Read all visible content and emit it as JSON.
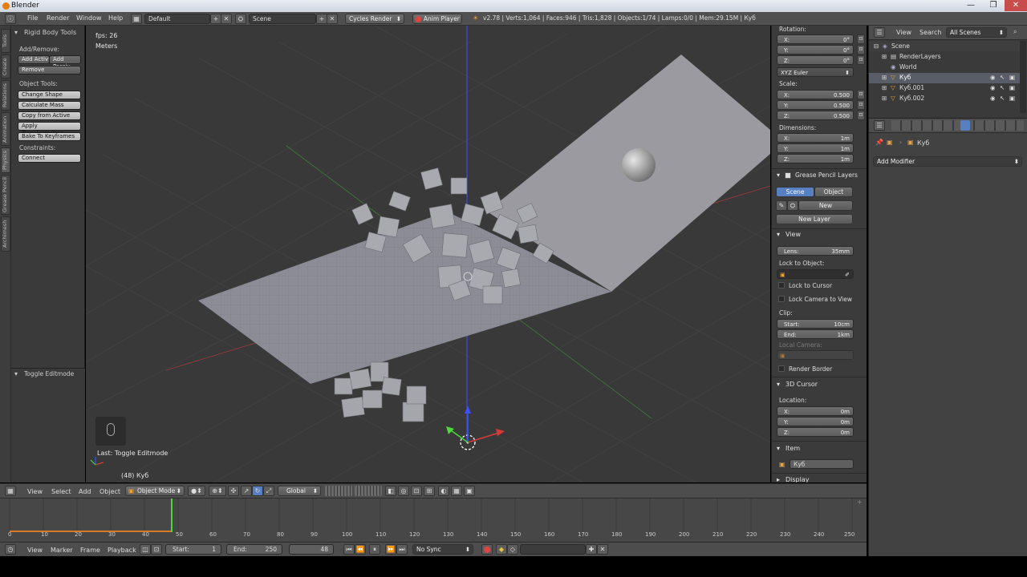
{
  "window": {
    "title": "Blender",
    "controls": [
      "—",
      "❐",
      "✕"
    ]
  },
  "menubar": {
    "menus": [
      "File",
      "Render",
      "Window",
      "Help"
    ],
    "layout_value": "Default",
    "scene_value": "Scene",
    "engine": "Cycles Render",
    "anim_player": "Anim Player",
    "stats": "v2.78 | Verts:1,064 | Faces:946 | Tris:1,828 | Objects:1/74 | Lamps:0/0 | Mem:29.15M | Куб"
  },
  "tabs": [
    "Tools",
    "Create",
    "Relations",
    "Animation",
    "Physics",
    "Grease Pencil",
    "Archimesh"
  ],
  "toolshelf": {
    "title": "Rigid Body Tools",
    "add_remove_label": "Add/Remove:",
    "add_active": "Add Activ",
    "add_passive": "Add Passiv",
    "remove": "Remove",
    "object_tools_label": "Object Tools:",
    "object_tools": [
      "Change Shape",
      "Calculate Mass",
      "Copy from Active",
      "Apply Transformation",
      "Bake To Keyframes"
    ],
    "constraints_label": "Constraints:",
    "connect": "Connect",
    "last_op_panel": "Toggle Editmode"
  },
  "viewport": {
    "fps": "fps: 26",
    "units": "Meters",
    "last_op": "Last: Toggle Editmode",
    "object_info": "(48) Куб"
  },
  "npanel": {
    "rotation_label": "Rotation:",
    "rotation": [
      {
        "axis": "X:",
        "value": "0°"
      },
      {
        "axis": "Y:",
        "value": "0°"
      },
      {
        "axis": "Z:",
        "value": "0°"
      }
    ],
    "rotation_mode": "XYZ Euler",
    "scale_label": "Scale:",
    "scale": [
      {
        "axis": "X:",
        "value": "0.500"
      },
      {
        "axis": "Y:",
        "value": "0.500"
      },
      {
        "axis": "Z:",
        "value": "0.500"
      }
    ],
    "dimensions_label": "Dimensions:",
    "dimensions": [
      {
        "axis": "X:",
        "value": "1m"
      },
      {
        "axis": "Y:",
        "value": "1m"
      },
      {
        "axis": "Z:",
        "value": "1m"
      }
    ],
    "grease_pencil": "Grease Pencil Layers",
    "gp_scene": "Scene",
    "gp_object": "Object",
    "gp_new": "New",
    "gp_new_layer": "New Layer",
    "view_head": "View",
    "lens_label": "Lens:",
    "lens_value": "35mm",
    "lock_to_object": "Lock to Object:",
    "lock_to_cursor": "Lock to Cursor",
    "lock_camera": "Lock Camera to View",
    "clip_label": "Clip:",
    "clip_start_label": "Start:",
    "clip_start": "10cm",
    "clip_end_label": "End:",
    "clip_end": "1km",
    "local_camera": "Local Camera:",
    "render_border": "Render Border",
    "cursor_head": "3D Cursor",
    "location_label": "Location:",
    "location": [
      {
        "axis": "X:",
        "value": "0m"
      },
      {
        "axis": "Y:",
        "value": "0m"
      },
      {
        "axis": "Z:",
        "value": "0m"
      }
    ],
    "item_head": "Item",
    "item_name": "Куб",
    "display_head": "Display"
  },
  "outliner": {
    "view": "View",
    "search": "Search",
    "scenes": "All Scenes",
    "items": [
      "Scene",
      "RenderLayers",
      "World",
      "Куб",
      "Куб.001",
      "Куб.002"
    ]
  },
  "properties": {
    "object_name": "Куб",
    "add_modifier": "Add Modifier"
  },
  "viewport_header": {
    "menus": [
      "View",
      "Select",
      "Add",
      "Object"
    ],
    "mode": "Object Mode",
    "orientation": "Global"
  },
  "timeline": {
    "ticks": [
      "0",
      "10",
      "20",
      "30",
      "40",
      "50",
      "60",
      "70",
      "80",
      "90",
      "100",
      "110",
      "120",
      "130",
      "140",
      "150",
      "160",
      "170",
      "180",
      "190",
      "200",
      "210",
      "220",
      "230",
      "240",
      "250"
    ],
    "menus": [
      "View",
      "Marker",
      "Frame",
      "Playback"
    ],
    "start_label": "Start:",
    "start_value": "1",
    "end_label": "End:",
    "end_value": "250",
    "current_frame": "48",
    "sync": "No Sync"
  },
  "colors": {
    "accent_blue": "#5680c2",
    "background": "#393939",
    "axis_red": "#c83c3c",
    "axis_green": "#5ac83c",
    "axis_blue": "#3c50ff"
  }
}
